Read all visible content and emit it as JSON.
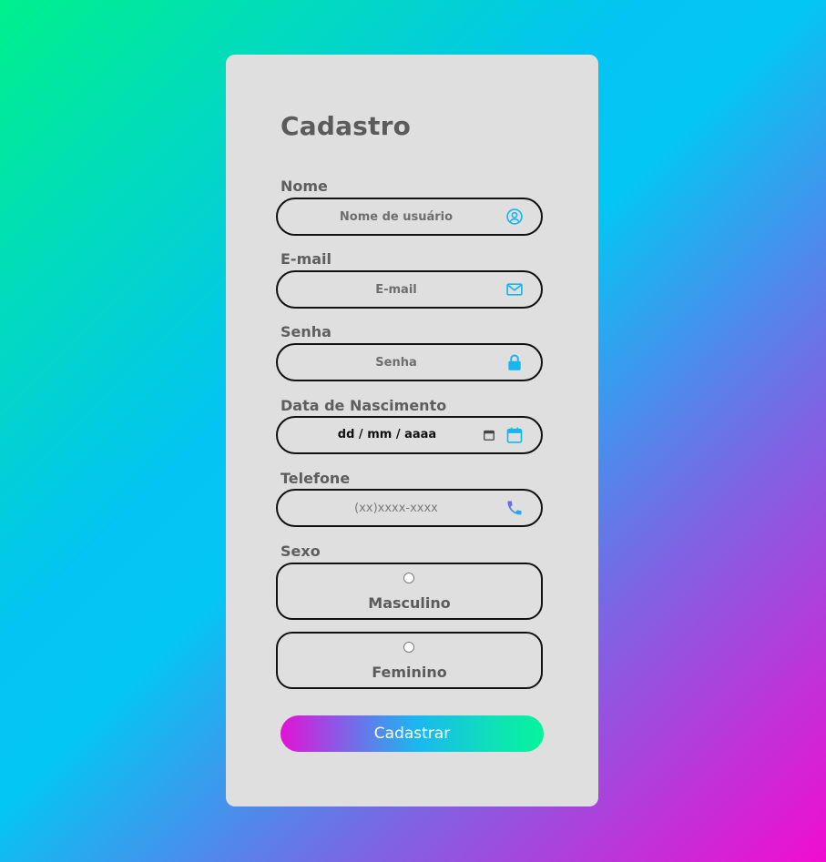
{
  "form": {
    "title": "Cadastro",
    "fields": [
      {
        "label": "Nome",
        "placeholder": "Nome de usuário",
        "icon": "user-circle-icon"
      },
      {
        "label": "E-mail",
        "placeholder": "E-mail",
        "icon": "envelope-icon"
      },
      {
        "label": "Senha",
        "placeholder": "Senha",
        "icon": "lock-icon"
      },
      {
        "label": "Data de Nascimento",
        "value": "dd / mm / aaaa",
        "icon": "calendar-icon"
      },
      {
        "label": "Telefone",
        "placeholder": "(xx)xxxx-xxxx",
        "icon": "phone-icon"
      }
    ],
    "sex": {
      "label": "Sexo",
      "options": [
        "Masculino",
        "Feminino"
      ]
    },
    "submit_label": "Cadastrar"
  },
  "colors": {
    "card_bg": "#e0dfdf",
    "text_gray": "#5b5b5b",
    "icon_cyan": "#16b6f0",
    "gradient_start": "#00f08c",
    "gradient_mid": "#04c6f4",
    "gradient_end": "#f20ccf"
  }
}
